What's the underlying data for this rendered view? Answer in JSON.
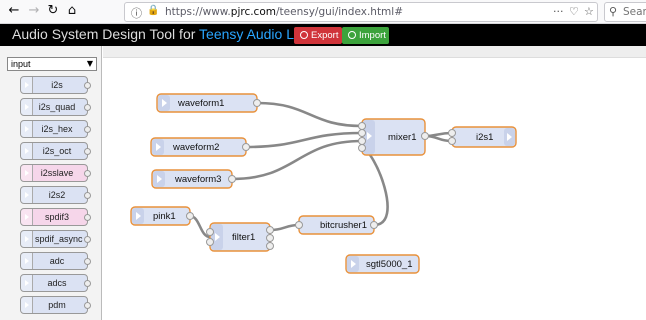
{
  "browser": {
    "url_prefix": "https://www.",
    "url_domain": "pjrc.com",
    "url_path": "/teensy/gui/index.html#",
    "search_placeholder": "Searc",
    "back_icon": "back-arrow",
    "forward_icon": "forward-arrow",
    "reload_icon": "reload",
    "home_icon": "home"
  },
  "header": {
    "title_prefix": "Audio System Design Tool for ",
    "title_highlight": "Teensy Audio Library",
    "export_label": "Export",
    "import_label": "Import",
    "colors": {
      "export": "#d0343a",
      "import": "#3ca33c",
      "highlight": "#2aa6ff"
    }
  },
  "palette": {
    "category": "input",
    "items": [
      {
        "label": "i2s",
        "pink": false
      },
      {
        "label": "i2s_quad",
        "pink": false
      },
      {
        "label": "i2s_hex",
        "pink": false
      },
      {
        "label": "i2s_oct",
        "pink": false
      },
      {
        "label": "i2sslave",
        "pink": true
      },
      {
        "label": "i2s2",
        "pink": false
      },
      {
        "label": "spdif3",
        "pink": true
      },
      {
        "label": "spdif_async",
        "pink": false
      },
      {
        "label": "adc",
        "pink": false
      },
      {
        "label": "adcs",
        "pink": false
      },
      {
        "label": "pdm",
        "pink": false
      }
    ]
  },
  "nodes": {
    "waveform1": "waveform1",
    "waveform2": "waveform2",
    "waveform3": "waveform3",
    "pink1": "pink1",
    "filter1": "filter1",
    "bitcrusher1": "bitcrusher1",
    "mixer1": "mixer1",
    "i2s1": "i2s1",
    "sgtl5000_1": "sgtl5000_1"
  }
}
